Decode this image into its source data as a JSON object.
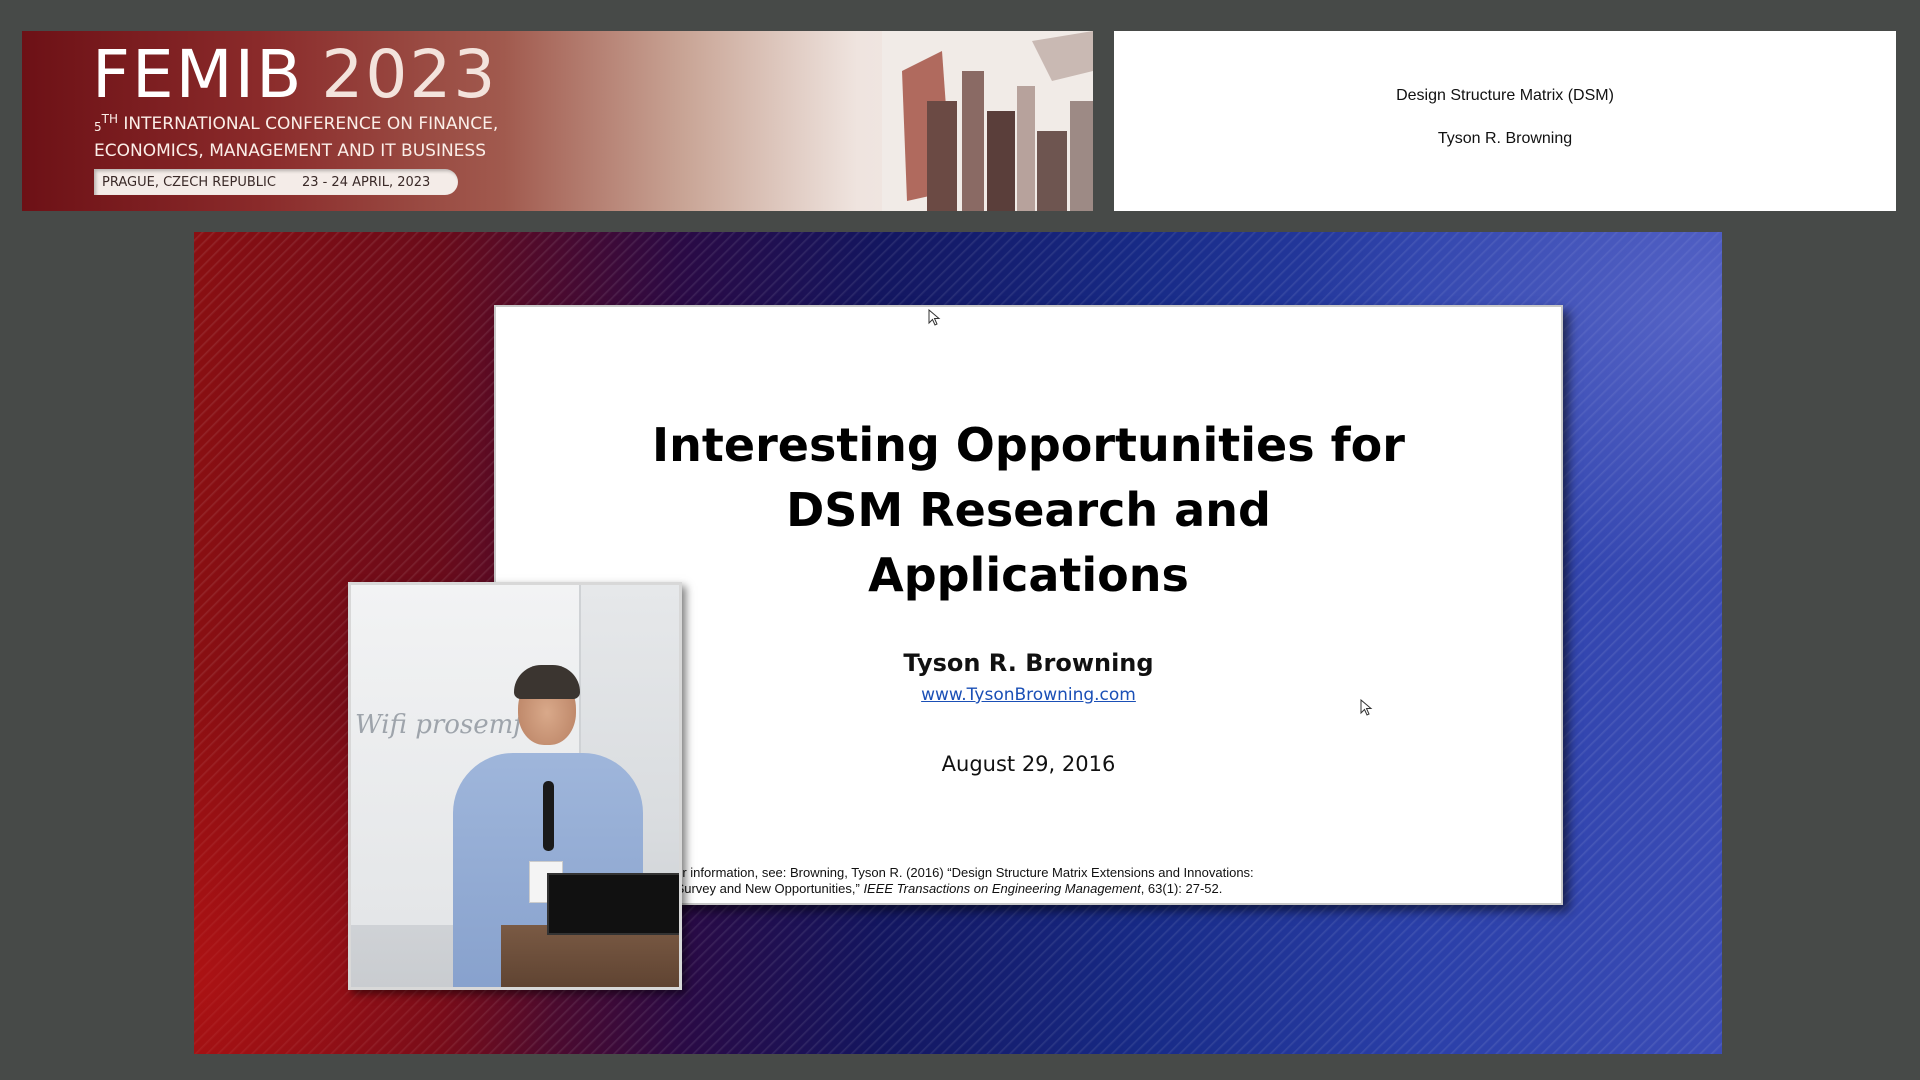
{
  "banner": {
    "title_part1": "FEMIB",
    "title_part2": "2023",
    "ordinal_number": "5",
    "ordinal_suffix": "TH",
    "subtitle_line1": "INTERNATIONAL CONFERENCE ON FINANCE,",
    "subtitle_line2": "ECONOMICS, MANAGEMENT AND IT BUSINESS",
    "location": "PRAGUE, CZECH REPUBLIC",
    "dates": "23 - 24 APRIL, 2023",
    "colors": {
      "dark_red": "#6d1116",
      "light": "#f3ede9"
    }
  },
  "title_box": {
    "title": "Design Structure Matrix (DSM)",
    "author": "Tyson R. Browning"
  },
  "slide": {
    "title_line1": "Interesting Opportunities for",
    "title_line2": "DSM Research and",
    "title_line3": "Applications",
    "author": "Tyson R. Browning",
    "link": "www.TysonBrowning.com",
    "date": "August 29, 2016",
    "reference_line1": "For further information, see:  Browning, Tyson R. (2016) “Design Structure Matrix Extensions and Innovations:",
    "reference_line2_plain": "A Survey and New Opportunities,” ",
    "reference_journal": "IEEE Transactions on Engineering Management",
    "reference_tail": ", 63(1): 27-52."
  },
  "video": {
    "whiteboard_text": "Wifi  prosemf"
  },
  "icons": [
    "cursor-icon",
    "cursor-icon"
  ]
}
